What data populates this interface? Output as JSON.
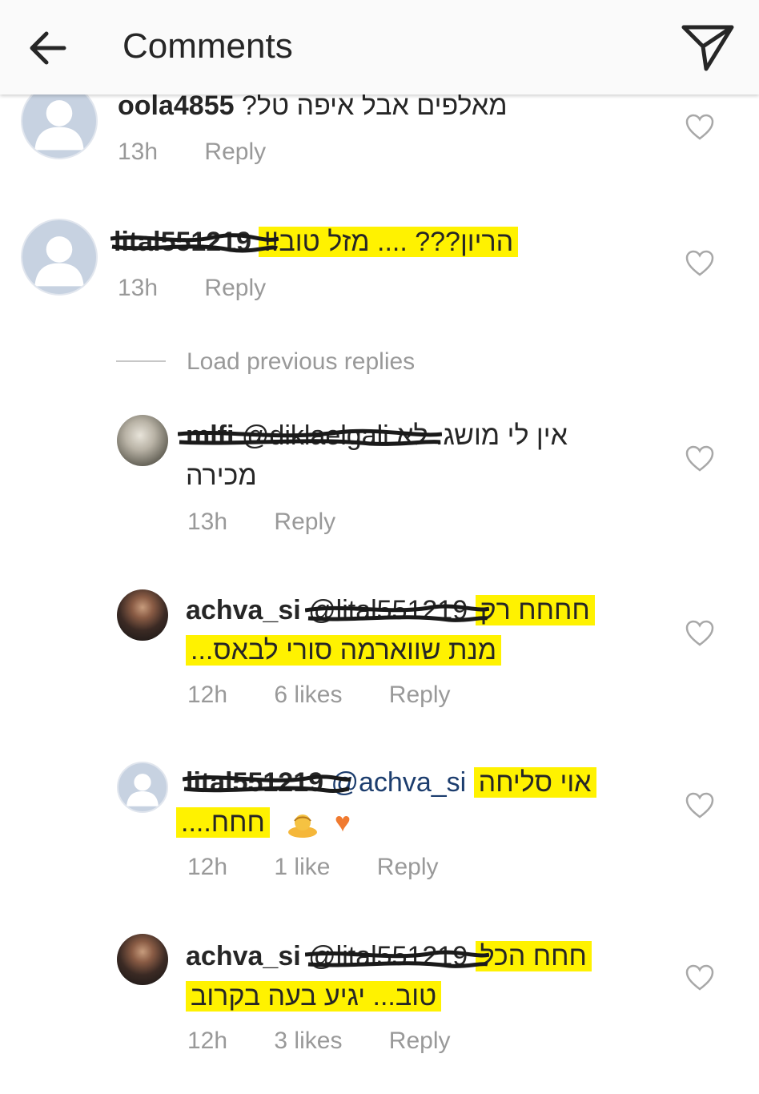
{
  "header": {
    "title": "Comments"
  },
  "comments": [
    {
      "username": "oola4855",
      "text": "מאלפים אבל איפה טל?",
      "time": "13h",
      "reply": "Reply"
    },
    {
      "username": "lital551219",
      "text": "הריון??? .... מזל טוב!!",
      "time": "13h",
      "reply": "Reply"
    }
  ],
  "load_previous": "Load previous replies",
  "replies": [
    {
      "username": "mlfi",
      "mention": "@diklaelgali",
      "text_line1": "אין לי מושג. לא",
      "text_line2": "מכירה",
      "time": "13h",
      "reply": "Reply"
    },
    {
      "username": "achva_si",
      "mention": "@lital551219",
      "text_line1": "חחחח רק",
      "text_line2": "מנת שווארמה סורי לבאס...",
      "time": "12h",
      "likes": "6 likes",
      "reply": "Reply"
    },
    {
      "username": "lital551219",
      "mention": "@achva_si",
      "text_line1": "אוי סליחה",
      "text_line2": "חחח....",
      "time": "12h",
      "likes": "1 like",
      "reply": "Reply"
    },
    {
      "username": "achva_si",
      "mention": "@lital551219",
      "text_line1": "חחח הכל",
      "text_line2": "טוב... יגיע בעה בקרוב",
      "time": "12h",
      "likes": "3 likes",
      "reply": "Reply"
    }
  ],
  "icons": {
    "back": "arrow-left-icon",
    "send": "paper-plane-icon",
    "like": "heart-outline-icon",
    "avatar": "default-avatar-icon",
    "emoji_heart": "orange-heart-emoji",
    "emoji_bow": "person-bowing-emoji"
  },
  "colors": {
    "highlight": "#fff200",
    "mention": "#1c3d6e",
    "meta": "#999999",
    "emoji_heart": "#f07a30"
  }
}
